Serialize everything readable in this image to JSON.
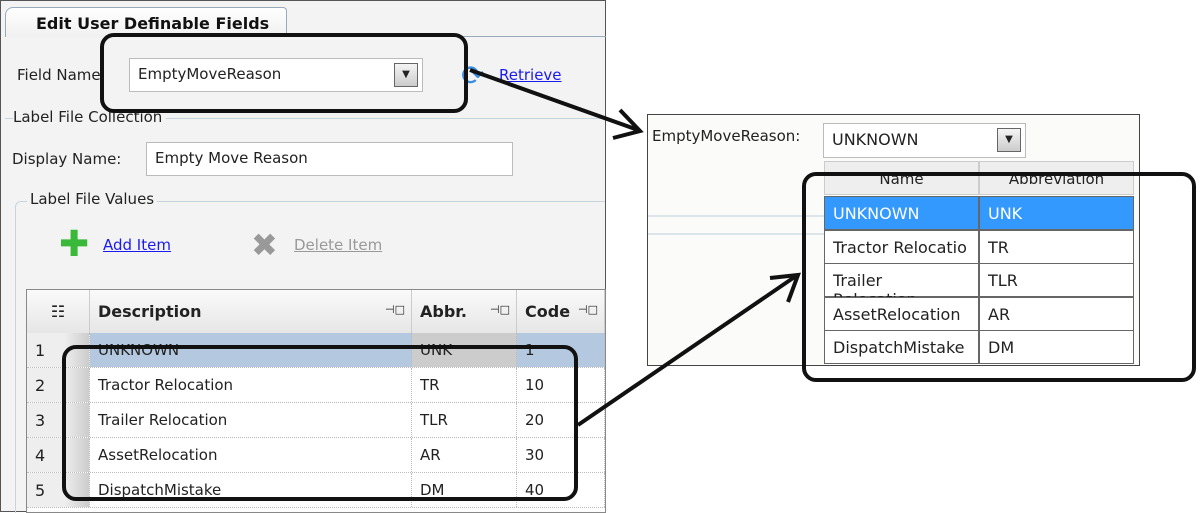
{
  "tab": {
    "title": "Edit User Definable Fields"
  },
  "form": {
    "field_name_label": "Field Name:",
    "field_name_value": "EmptyMoveReason",
    "retrieve_label": "Retrieve",
    "collection_label": "Label File Collection",
    "display_name_label": "Display Name:",
    "display_name_value": "Empty Move Reason",
    "values_label": "Label File Values",
    "add_item": "Add Item",
    "delete_item": "Delete Item"
  },
  "grid": {
    "columns": [
      "Description",
      "Abbr.",
      "Code"
    ],
    "rows": [
      {
        "num": "1",
        "description": "UNKNOWN",
        "abbr": "UNK",
        "code": "1"
      },
      {
        "num": "2",
        "description": "Tractor Relocation",
        "abbr": "TR",
        "code": "10"
      },
      {
        "num": "3",
        "description": "Trailer Relocation",
        "abbr": "TLR",
        "code": "20"
      },
      {
        "num": "4",
        "description": "AssetRelocation",
        "abbr": "AR",
        "code": "30"
      },
      {
        "num": "5",
        "description": "DispatchMistake",
        "abbr": "DM",
        "code": "40"
      }
    ]
  },
  "preview": {
    "label": "EmptyMoveReason:",
    "value": "UNKNOWN",
    "columns": [
      "Name",
      "Abbreviation"
    ],
    "rows": [
      {
        "name": "UNKNOWN",
        "abbr": "UNK"
      },
      {
        "name": "Tractor Relocatio",
        "abbr": "TR"
      },
      {
        "name": "Trailer Relocation",
        "abbr": "TLR"
      },
      {
        "name": "AssetRelocation",
        "abbr": "AR"
      },
      {
        "name": "DispatchMistake",
        "abbr": "DM"
      }
    ]
  },
  "colors": {
    "selected_row": "#b4c8e0",
    "dropdown_highlight": "#3399ff",
    "link": "#1a1aee"
  }
}
